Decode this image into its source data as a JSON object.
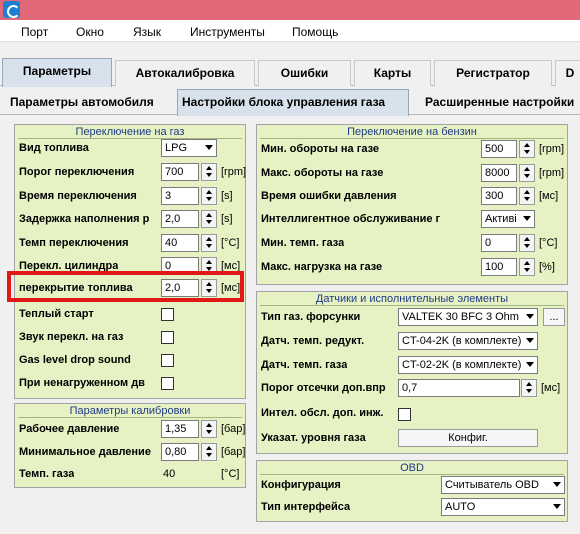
{
  "menu": [
    "Порт",
    "Окно",
    "Язык",
    "Инструменты",
    "Помощь"
  ],
  "main_tabs": [
    "Параметры",
    "Автокалибровка",
    "Ошибки",
    "Карты",
    "Регистратор",
    "D"
  ],
  "sub_tabs": [
    "Параметры автомобиля",
    "Настройки блока управления газа",
    "Расширенные настройки"
  ],
  "gas_switch": {
    "title": "Переключение на газ",
    "fuel_type": {
      "label": "Вид топлива",
      "value": "LPG"
    },
    "switch_threshold": {
      "label": "Порог переключения",
      "value": "700",
      "unit": "[rpm]"
    },
    "switch_time": {
      "label": "Время переключения",
      "value": "3",
      "unit": "[s]"
    },
    "fill_delay": {
      "label": "Задержка наполнения р",
      "value": "2,0",
      "unit": "[s]"
    },
    "switch_temp": {
      "label": "Темп переключения",
      "value": "40",
      "unit": "[°C]"
    },
    "cylinder_switch": {
      "label": "Перекл. цилиндра",
      "value": "0",
      "unit": "[мс]"
    },
    "fuel_overlap": {
      "label": "перекрытие топлива",
      "value": "2,0",
      "unit": "[мс]"
    },
    "warm_start": {
      "label": "Теплый старт"
    },
    "switch_sound": {
      "label": "Звук перекл. на газ"
    },
    "gas_drop_sound": {
      "label": "Gas level drop sound"
    },
    "unloaded": {
      "label": "При ненагруженном дв"
    }
  },
  "calibration": {
    "title": "Параметры калибровки",
    "work_pressure": {
      "label": "Рабочее давление",
      "value": "1,35",
      "unit": "[бар]"
    },
    "min_pressure": {
      "label": "Минимальное давление",
      "value": "0,80",
      "unit": "[бар]"
    },
    "gas_temp": {
      "label": "Темп. газа",
      "value": "40",
      "unit": "[°C]"
    }
  },
  "petrol_switch": {
    "title": "Переключение на бензин",
    "min_rpm": {
      "label": "Мин. обороты на газе",
      "value": "500",
      "unit": "[rpm]"
    },
    "max_rpm": {
      "label": "Макс. обороты на газе",
      "value": "8000",
      "unit": "[rpm]"
    },
    "pressure_error_time": {
      "label": "Время ошибки давления",
      "value": "300",
      "unit": "[мс]"
    },
    "smart_service": {
      "label": "Интеллигентное обслуживание г",
      "value": "Активі"
    },
    "min_gas_temp": {
      "label": "Мин. темп. газа",
      "value": "0",
      "unit": "[°C]"
    },
    "max_load": {
      "label": "Макс. нагрузка на газе",
      "value": "100",
      "unit": "[%]"
    }
  },
  "sensors": {
    "title": "Датчики и исполнительные элементы",
    "injector_type": {
      "label": "Тип газ. форсунки",
      "value": "VALTEK 30 BFC 3 Ohm",
      "button": "..."
    },
    "reducer_temp_sensor": {
      "label": "Датч. темп. редукт.",
      "value": "CT-04-2K (в комплекте)"
    },
    "gas_temp_sensor": {
      "label": "Датч. темп. газа",
      "value": "CT-02-2K (в комплекте)"
    },
    "cutoff_threshold": {
      "label": "Порог отсечки доп.впр",
      "value": "0,7",
      "unit": "[мс]"
    },
    "intel_service_inj": {
      "label": "Интел. обсл. доп. инж."
    },
    "level_indicator": {
      "label": "Указат. уровня газа",
      "button": "Конфиг."
    }
  },
  "obd": {
    "title": "OBD",
    "configuration": {
      "label": "Конфигурация",
      "value": "Считыватель OBD"
    },
    "interface_type": {
      "label": "Тип интерфейса",
      "value": "AUTO"
    }
  }
}
